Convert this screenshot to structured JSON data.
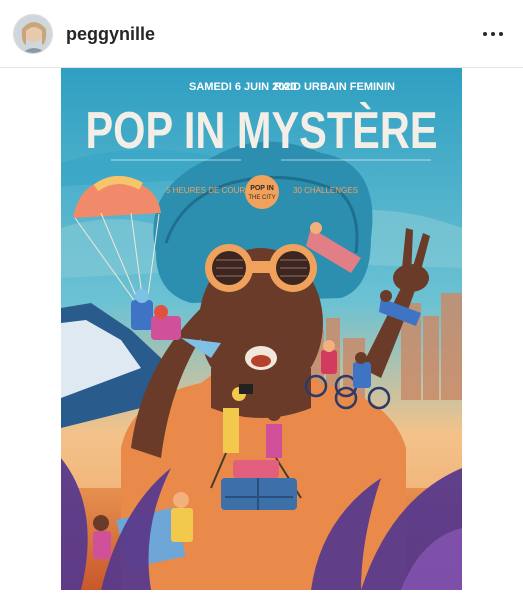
{
  "post": {
    "username": "peggynille",
    "more_icon": "more-horizontal-icon"
  },
  "poster": {
    "date": "SAMEDI 6 JUIN 2020",
    "event_type": "RAID URBAIN FEMININ",
    "title": "POP IN MYSTÈRE",
    "subline_left": "5 HEURES DE COURSE",
    "subline_right": "30 CHALLENGES",
    "badge_line1": "POP IN",
    "badge_line2": "THE CITY",
    "colors": {
      "sky_top": "#2f9fc2",
      "sky_mid": "#5cb9cf",
      "hair": "#2c8fb0",
      "skin": "#6b3b2a",
      "body_orange": "#e98a4a",
      "sunset": "#f3b57a",
      "sea": "#d9743e",
      "leaf_purple": "#5a3a8c",
      "title_white": "#f4efe6"
    }
  }
}
